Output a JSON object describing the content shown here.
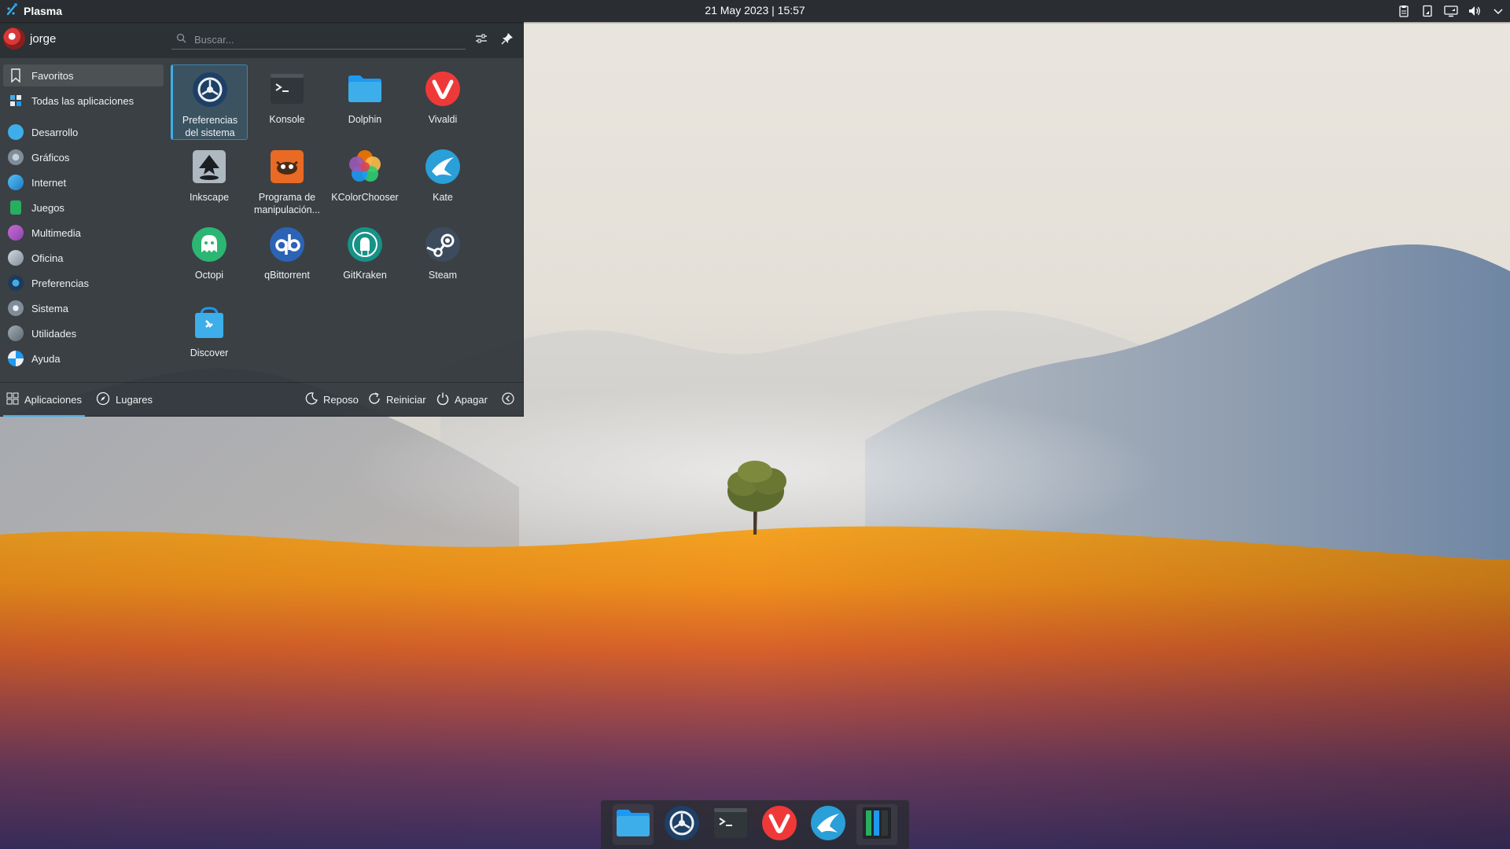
{
  "top_panel": {
    "launcher_label": "Plasma",
    "clock": "21 May 2023 | 15:57",
    "tray_icons": [
      "clipboard-icon",
      "device-icon",
      "network-icon",
      "volume-icon",
      "chevron-down-icon"
    ]
  },
  "menu": {
    "user": {
      "name": "jorge"
    },
    "search": {
      "placeholder": "Buscar..."
    },
    "categories": [
      {
        "label": "Favoritos",
        "icon": "bookmark-icon",
        "active": true
      },
      {
        "label": "Todas las aplicaciones",
        "icon": "all-apps-icon"
      },
      {
        "label": "Desarrollo",
        "icon": "development-icon",
        "color": "#3daee9"
      },
      {
        "label": "Gráficos",
        "icon": "graphics-icon",
        "color": "#7f8c9a"
      },
      {
        "label": "Internet",
        "icon": "internet-icon",
        "color": "#1d99f3"
      },
      {
        "label": "Juegos",
        "icon": "games-icon",
        "color": "#27ae60"
      },
      {
        "label": "Multimedia",
        "icon": "multimedia-icon",
        "color": "#9b59b6"
      },
      {
        "label": "Oficina",
        "icon": "office-icon",
        "color": "#8a949b"
      },
      {
        "label": "Preferencias",
        "icon": "preferences-icon",
        "color": "#2c4f7c"
      },
      {
        "label": "Sistema",
        "icon": "system-icon",
        "color": "#7f8c9a"
      },
      {
        "label": "Utilidades",
        "icon": "utilities-icon",
        "color": "#6c7a86"
      },
      {
        "label": "Ayuda",
        "icon": "help-icon",
        "color": "#1d99f3"
      }
    ],
    "apps": [
      {
        "label": "Preferencias del sistema",
        "icon": "system-settings-icon",
        "selected": true
      },
      {
        "label": "Konsole",
        "icon": "terminal-icon"
      },
      {
        "label": "Dolphin",
        "icon": "folder-icon"
      },
      {
        "label": "Vivaldi",
        "icon": "vivaldi-icon"
      },
      {
        "label": "Inkscape",
        "icon": "inkscape-icon"
      },
      {
        "label": "Programa de manipulación...",
        "icon": "gimp-icon"
      },
      {
        "label": "KColorChooser",
        "icon": "color-chooser-icon"
      },
      {
        "label": "Kate",
        "icon": "kate-icon"
      },
      {
        "label": "Octopi",
        "icon": "octopi-icon"
      },
      {
        "label": "qBittorrent",
        "icon": "qbittorrent-icon"
      },
      {
        "label": "GitKraken",
        "icon": "gitkraken-icon"
      },
      {
        "label": "Steam",
        "icon": "steam-icon"
      },
      {
        "label": "Discover",
        "icon": "discover-icon"
      }
    ],
    "footer": {
      "tab_apps": "Aplicaciones",
      "tab_places": "Lugares",
      "sleep": "Reposo",
      "restart": "Reiniciar",
      "shutdown": "Apagar"
    }
  },
  "dock": {
    "items": [
      "folder-icon",
      "system-settings-icon",
      "terminal-icon",
      "vivaldi-icon",
      "kate-icon",
      "split-window-icon"
    ]
  }
}
